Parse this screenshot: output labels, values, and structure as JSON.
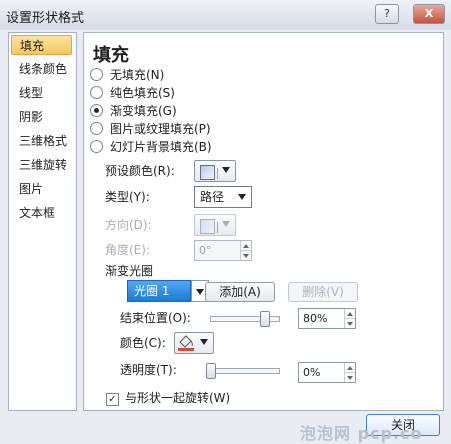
{
  "window": {
    "title": "设置形状格式",
    "help_button": "?",
    "close_button": "X"
  },
  "sidebar": {
    "items": [
      {
        "label": "填充"
      },
      {
        "label": "线条颜色"
      },
      {
        "label": "线型"
      },
      {
        "label": "阴影"
      },
      {
        "label": "三维格式"
      },
      {
        "label": "三维旋转"
      },
      {
        "label": "图片"
      },
      {
        "label": "文本框"
      }
    ],
    "selected": "填充"
  },
  "panel": {
    "heading": "填充",
    "fill_options": [
      {
        "label": "无填充(N)",
        "checked": false
      },
      {
        "label": "纯色填充(S)",
        "checked": false
      },
      {
        "label": "渐变填充(G)",
        "checked": true
      },
      {
        "label": "图片或纹理填充(P)",
        "checked": false
      },
      {
        "label": "幻灯片背景填充(B)",
        "checked": false
      }
    ],
    "preset_colors_label": "预设颜色(R):",
    "type_label": "类型(Y):",
    "type_value": "路径",
    "direction_label": "方向(D):",
    "angle_label": "角度(E):",
    "angle_value": "0°",
    "gradient_stops_label": "渐变光圈",
    "stop_selected": "光圈 1",
    "add_button": "添加(A)",
    "remove_button": "删除(V)",
    "end_position_label": "结束位置(O):",
    "end_position_value": "80%",
    "end_position_fraction": 0.8,
    "color_label": "颜色(C):",
    "transparency_label": "透明度(T):",
    "transparency_value": "0%",
    "transparency_fraction": 0.0,
    "rotate_with_shape_label": "与形状一起旋转(W)",
    "rotate_with_shape_checked": true
  },
  "footer": {
    "close_button": "关闭"
  },
  "watermark": "泡泡网 pcp.co"
}
